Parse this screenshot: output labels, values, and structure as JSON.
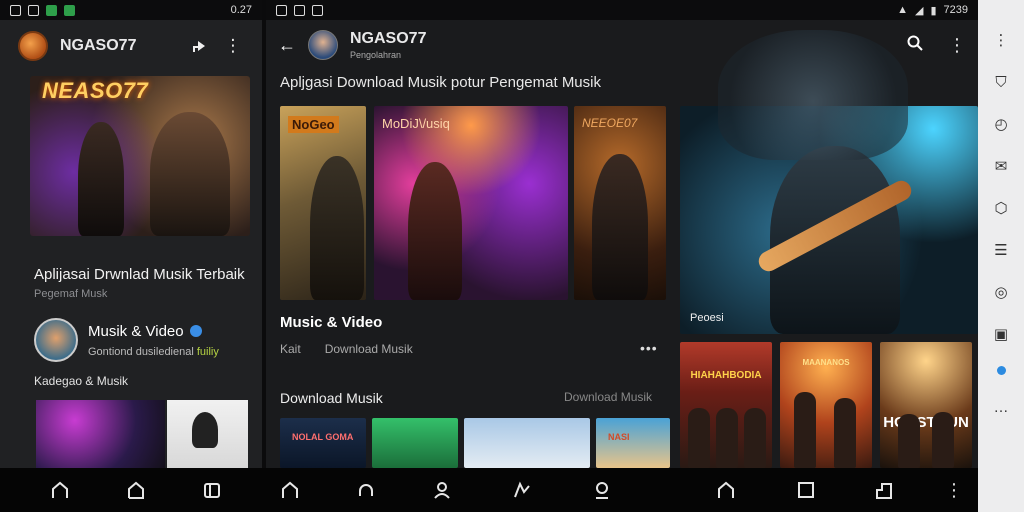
{
  "status_left": {
    "time": "0.27"
  },
  "status_right": {
    "time": "7239"
  },
  "left_panel": {
    "channel_name": "NGASO77",
    "hero_title": "NEASO77",
    "hero_caption": "Aplijasai Drwnlad Musik Terbaik",
    "hero_subtitle": "Pegemaf Musk",
    "channel_row": {
      "name": "Musik & Video",
      "description_start": "Gontiond dusiledienal",
      "description_accent": "fuiliy"
    },
    "section_label": "Kadegao & Musik"
  },
  "main": {
    "title": "NGASO77",
    "subtitle": "Pengolahran",
    "heading": "Apljgasi Download Musik potur Pengemat Musik",
    "cards": [
      {
        "label": "NoGeo"
      },
      {
        "label": "MoDiJ\\/usiq"
      },
      {
        "label": "NEEOE07"
      },
      {
        "label": "Peoesi"
      }
    ],
    "music_video": {
      "heading": "Music & Video",
      "tags": [
        "Kait",
        "Download Musik"
      ]
    },
    "download": {
      "heading": "Download Musik",
      "link": "Download Musik",
      "thumbs": [
        {
          "label": "NOLAL GOMA"
        },
        {
          "label": ""
        },
        {
          "label": ""
        },
        {
          "label": "NASI"
        }
      ]
    },
    "posters": [
      {
        "label": "HIAHAHBODIA"
      },
      {
        "label": "MAANANOS"
      },
      {
        "label": "HOASTOUN"
      }
    ]
  },
  "colors": {
    "accent_blue": "#2c8be0",
    "verify_badge": "#3a8ee6",
    "hero_title": "#ffcf62"
  },
  "icons": {
    "header_left": [
      "share-icon",
      "more-vertical-icon"
    ],
    "header_right": [
      "search-icon",
      "more-vertical-icon"
    ],
    "rail": [
      "more-vertical-icon",
      "shield-icon",
      "clock-icon",
      "mail-icon",
      "cube-icon",
      "list-icon",
      "target-icon",
      "image-icon",
      "dot-indicator",
      "more-horizontal-icon"
    ],
    "navbar": [
      "home-icon",
      "home-icon",
      "tab-icon",
      "home-icon",
      "headphones-icon",
      "user-icon",
      "route-icon",
      "profile-icon",
      "home-icon",
      "square-icon",
      "layers-icon",
      "more-vertical-icon"
    ]
  }
}
